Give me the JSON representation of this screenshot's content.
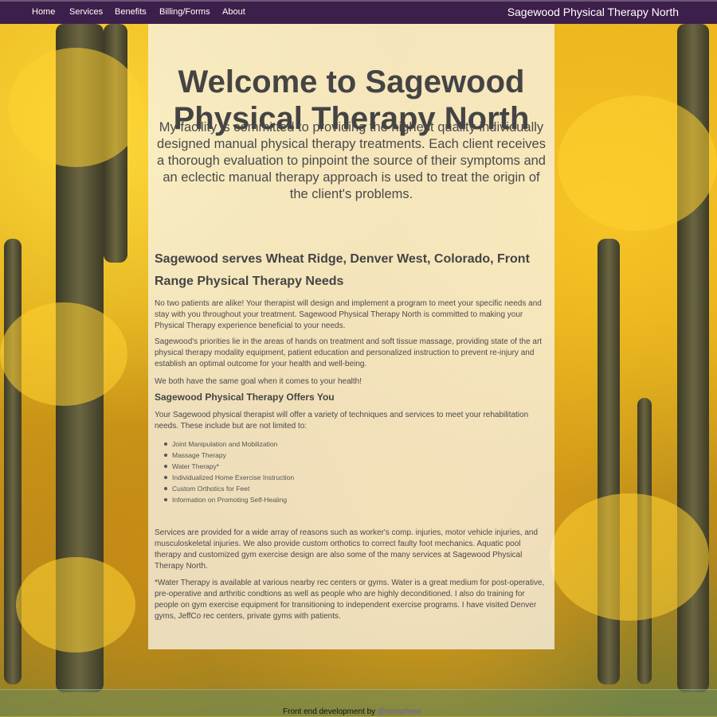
{
  "nav": {
    "items": [
      "Home",
      "Services",
      "Benefits",
      "Billing/Forms",
      "About"
    ],
    "brand": "Sagewood Physical Therapy North"
  },
  "hero": {
    "title": "Welcome to Sagewood Physical Therapy North",
    "text": "My facility is committed to providing the highest quality individually designed manual physical therapy treatments. Each client receives a thorough evaluation to pinpoint the source of their symptoms and an eclectic manual therapy approach is used to treat the origin of the client's problems."
  },
  "section": {
    "title": "Sagewood serves Wheat Ridge, Denver West, Colorado, Front Range Physical Therapy Needs",
    "p1": "No two patients are alike! Your therapist will design and implement a program to meet your specific needs and stay with you throughout your treatment. Sagewood Physical Therapy North is committed to making your Physical Therapy experience beneficial to your needs.",
    "p2": "Sagewood's priorities lie in the areas of hands on treatment and soft tissue massage, providing state of the art physical therapy modality equipment, patient education and personalized instruction to prevent re-injury and establish an optimal outcome for your health and well-being.",
    "p3": "We both have the same goal when it comes to your health!"
  },
  "offers": {
    "title": "Sagewood Physical Therapy Offers You",
    "intro": "Your Sagewood physical therapist will offer a variety of techniques and services to meet your rehabilitation needs. These include but are not limited to:",
    "items": [
      "Joint Manipulation and Mobilization",
      "Massage Therapy",
      "Water Therapy*",
      "Individualized Home Exercise Instruction",
      "Custom Orthotics for Feet",
      "Information on Promoting Self-Healing"
    ],
    "p4": "Services are provided for a wide array of reasons such as worker's comp. injuries, motor vehicle injuries, and musculoskeletal injuries. We also provide custom orthotics to correct faulty foot mechanics. Aquatic pool therapy and customized gym exercise design are also some of the many services at Sagewood Physical Therapy North.",
    "p5": "*Water Therapy is available at various nearby rec centers or gyms. Water is a great medium for post-operative, pre-operative and arthritic condtions as well as people who are highly deconditioned. I also do training for people on gym exercise equipment for transitioning to independent exercise programs. I have visited Denver gyms, JeffCo rec centers, private gyms with patients."
  },
  "footer": {
    "text": "Front end development by",
    "link": "@mosphere"
  },
  "colors": {
    "nav_bg": "#3d1f4b",
    "panel_bg": "#f8f4e8",
    "heading": "#444444",
    "footer_link": "#7a5a9a"
  }
}
